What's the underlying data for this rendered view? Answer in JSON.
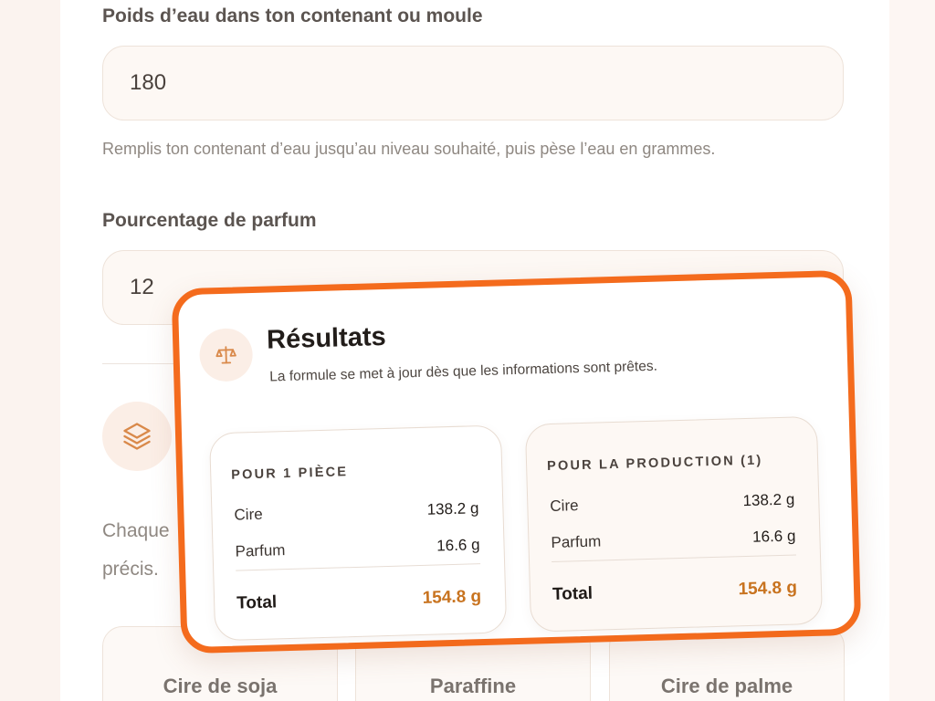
{
  "form": {
    "water_label": "Poids d’eau dans ton contenant ou moule",
    "water_value": "180",
    "water_help": "Remplis ton contenant d’eau jusqu’au niveau souhaité, puis pèse l’eau en grammes.",
    "perfume_label": "Pourcentage de parfum",
    "perfume_value": "12",
    "wax_desc_line1": "Chaque",
    "wax_desc_line2": "précis.",
    "wax_types": [
      "Cire de soja",
      "Paraffine",
      "Cire de palme"
    ]
  },
  "results": {
    "title": "Résultats",
    "subtitle": "La formule se met à jour dès que les informations sont prêtes.",
    "per_piece": {
      "heading": "POUR 1 PIÈCE",
      "rows": [
        {
          "label": "Cire",
          "value": "138.2 g"
        },
        {
          "label": "Parfum",
          "value": "16.6 g"
        }
      ],
      "total_label": "Total",
      "total_value": "154.8 g"
    },
    "production": {
      "heading": "POUR LA PRODUCTION (1)",
      "rows": [
        {
          "label": "Cire",
          "value": "138.2 g"
        },
        {
          "label": "Parfum",
          "value": "16.6 g"
        }
      ],
      "total_label": "Total",
      "total_value": "154.8 g"
    }
  },
  "icons": {
    "results": "scale-icon",
    "wax_section": "layers-icon"
  },
  "colors": {
    "accent": "#f46b1d",
    "total_value": "#c8731f",
    "icon": "#d9894a"
  }
}
